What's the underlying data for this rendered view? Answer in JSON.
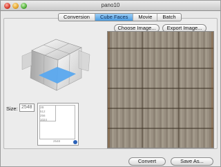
{
  "window": {
    "title": "pano10"
  },
  "tabs": [
    {
      "label": "Conversion",
      "active": false
    },
    {
      "label": "Cube Faces",
      "active": true
    },
    {
      "label": "Movie",
      "active": false
    },
    {
      "label": "Batch",
      "active": false
    }
  ],
  "buttons": {
    "choose_image": "Choose Image...",
    "export_image": "Export Image...",
    "convert": "Convert",
    "save_as": "Save As..."
  },
  "size": {
    "label": "Size:",
    "value": "2548"
  },
  "size_preview": {
    "labels": [
      "2B",
      "512",
      "256",
      "1024"
    ],
    "bottom_label": "2548"
  },
  "colors": {
    "accent": "#4b9be0",
    "cube_face": "#5aa8ee"
  },
  "icons": {
    "cube": "cube-faces-icon",
    "preview": "image-preview"
  }
}
